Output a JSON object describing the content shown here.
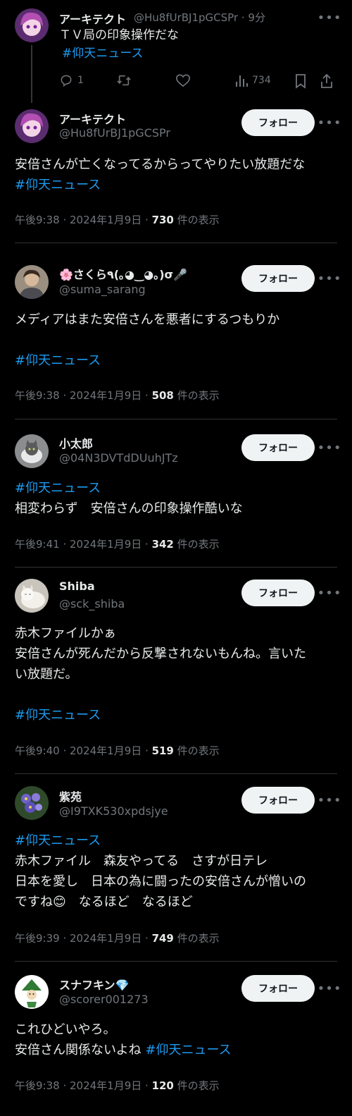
{
  "colors": {
    "background": "#000000",
    "text": "#e7e9ea",
    "muted": "#71767b",
    "link": "#1d9bf0",
    "divider": "#2f3336",
    "follow_bg": "#eff3f4"
  },
  "parent": {
    "name": "アーキテクト",
    "handle": "@Hu8fUrBJ1pGCSPr",
    "time": "· 9分",
    "line1": "ＴＶ局の印象操作だな",
    "hashtag": "#仰天ニュース",
    "replies": "1",
    "views": "734",
    "icons": {
      "reply": "reply-icon",
      "retweet": "retweet-icon",
      "like": "heart-icon",
      "views": "views-icon",
      "bookmark": "bookmark-icon",
      "share": "share-icon"
    }
  },
  "follow_label": "フォロー",
  "views_suffix": "件の表示",
  "posts": [
    {
      "name": "アーキテクト",
      "handle": "@Hu8fUrBJ1pGCSPr",
      "text1": "安倍さんが亡くなってるからってやりたい放題だな",
      "hashtag": "#仰天ニュース",
      "time": "午後9:38 · 2024年1月9日 · ",
      "views": "730"
    },
    {
      "name": "🌸さくら٩(｡◕‿◕｡)σ🎤",
      "handle": "@suma_sarang",
      "text1": "メディアはまた安倍さんを悪者にするつもりか",
      "hashtag": "#仰天ニュース",
      "time": "午後9:38 · 2024年1月9日 · ",
      "views": "508"
    },
    {
      "name": "小太郎",
      "handle": "@04N3DVTdDUuhJTz",
      "hashtag": "#仰天ニュース",
      "text1": "相変わらず　安倍さんの印象操作酷いな",
      "time": "午後9:41 · 2024年1月9日 · ",
      "views": "342"
    },
    {
      "name": "Shiba",
      "handle": "@sck_shiba",
      "text1": "赤木ファイルかぁ",
      "text2": "安倍さんが死んだから反撃されないもんね。言いた",
      "text3": "い放題だ。",
      "hashtag": "#仰天ニュース",
      "time": "午後9:40 · 2024年1月9日 · ",
      "views": "519"
    },
    {
      "name": "紫苑",
      "handle": "@I9TXK530xpdsjye",
      "hashtag": "#仰天ニュース",
      "text1": "赤木ファイル　森友やってる　さすが日テレ",
      "text2": "日本を愛し　日本の為に闘ったの安倍さんが憎いの",
      "text3": "ですね😊　なるほど　なるほど",
      "time": "午後9:39 · 2024年1月9日 · ",
      "views": "749"
    },
    {
      "name": "スナフキン💎",
      "handle": "@scorer001273",
      "text1": "これひどいやろ。",
      "text2": "安倍さん関係ないよね ",
      "hashtag": "#仰天ニュース",
      "time": "午後9:38 · 2024年1月9日 · ",
      "views": "120"
    }
  ]
}
